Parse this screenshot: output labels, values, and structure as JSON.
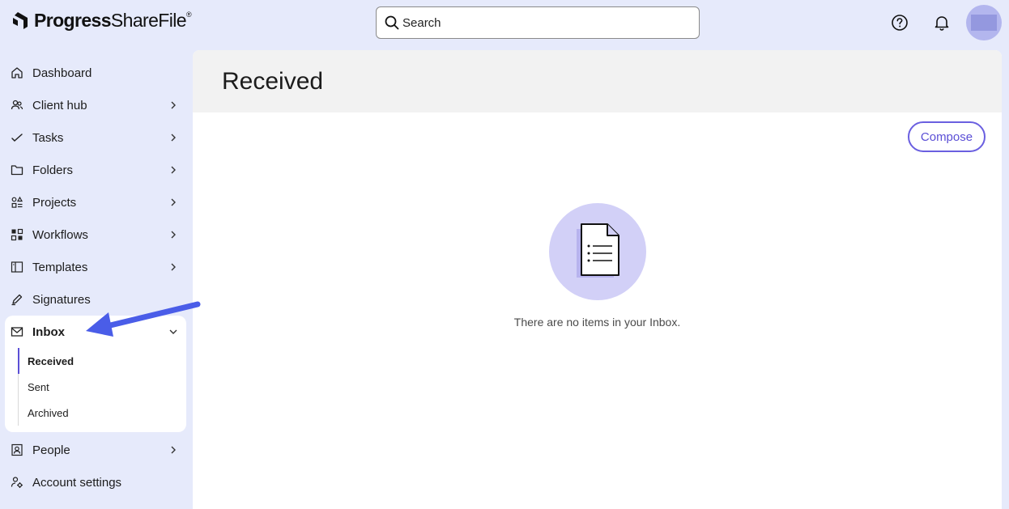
{
  "brand": {
    "name_bold": "Progress",
    "name_light": "ShareFile",
    "trademark": "®"
  },
  "search": {
    "placeholder": "Search"
  },
  "sidebar": {
    "items": [
      {
        "label": "Dashboard",
        "icon": "home-icon"
      },
      {
        "label": "Client hub",
        "icon": "users-icon"
      },
      {
        "label": "Tasks",
        "icon": "check-icon"
      },
      {
        "label": "Folders",
        "icon": "folder-icon"
      },
      {
        "label": "Projects",
        "icon": "projects-icon"
      },
      {
        "label": "Workflows",
        "icon": "workflow-icon"
      },
      {
        "label": "Templates",
        "icon": "template-icon"
      },
      {
        "label": "Signatures",
        "icon": "pen-icon"
      }
    ],
    "inbox": {
      "label": "Inbox",
      "icon": "mail-icon",
      "sub_items": [
        {
          "label": "Received"
        },
        {
          "label": "Sent"
        },
        {
          "label": "Archived"
        }
      ]
    },
    "bottom_items": [
      {
        "label": "People",
        "icon": "contact-icon"
      },
      {
        "label": "Account settings",
        "icon": "settings-icon"
      }
    ]
  },
  "main": {
    "title": "Received",
    "compose_label": "Compose",
    "empty_message": "There are no items in your Inbox."
  },
  "colors": {
    "accent": "#5b4fd6",
    "background": "#e6eafb",
    "annotation_arrow": "#4a5de8"
  }
}
